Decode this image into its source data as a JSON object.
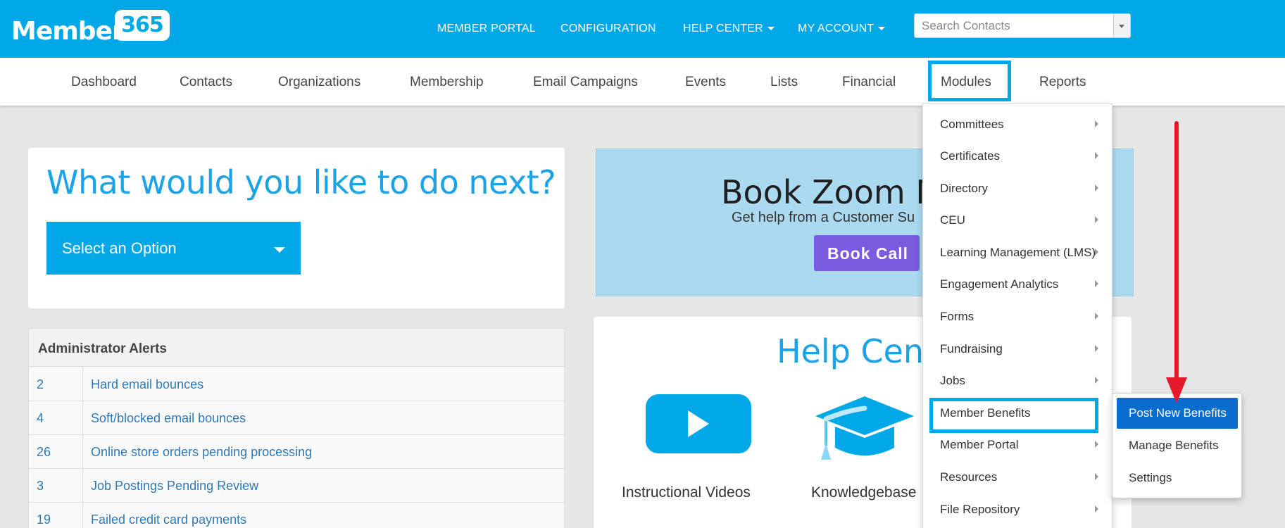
{
  "header": {
    "logo_text": "Member",
    "logo_badge": "365",
    "nav": [
      {
        "label": "MEMBER PORTAL"
      },
      {
        "label": "CONFIGURATION"
      },
      {
        "label": "HELP CENTER"
      },
      {
        "label": "MY ACCOUNT"
      }
    ],
    "search": {
      "placeholder": "Search Contacts"
    }
  },
  "main_nav": {
    "items": [
      {
        "label": "Dashboard"
      },
      {
        "label": "Contacts"
      },
      {
        "label": "Organizations"
      },
      {
        "label": "Membership"
      },
      {
        "label": "Email Campaigns"
      },
      {
        "label": "Events"
      },
      {
        "label": "Lists"
      },
      {
        "label": "Financial"
      },
      {
        "label": "Modules"
      },
      {
        "label": "Reports"
      }
    ]
  },
  "next_card": {
    "title": "What would you like to do next?",
    "select_label": "Select an Option"
  },
  "alerts": {
    "heading": "Administrator Alerts",
    "rows": [
      {
        "count": "2",
        "text": "Hard email bounces"
      },
      {
        "count": "4",
        "text": "Soft/blocked email bounces"
      },
      {
        "count": "26",
        "text": "Online store orders pending processing"
      },
      {
        "count": "3",
        "text": "Job Postings Pending Review"
      },
      {
        "count": "19",
        "text": "Failed credit card payments"
      }
    ]
  },
  "zoom_card": {
    "title": "Book Zoom M",
    "subtitle": "Get help from a Customer Su",
    "button": "Book Call"
  },
  "help_center": {
    "title": "Help Cente",
    "tiles": [
      {
        "label": "Instructional Videos",
        "icon": "youtube-play-icon"
      },
      {
        "label": "Knowledgebase",
        "icon": "graduation-cap-icon"
      }
    ]
  },
  "modules_menu": {
    "items": [
      {
        "label": "Committees"
      },
      {
        "label": "Certificates"
      },
      {
        "label": "Directory"
      },
      {
        "label": "CEU"
      },
      {
        "label": "Learning Management (LMS)"
      },
      {
        "label": "Engagement Analytics"
      },
      {
        "label": "Forms"
      },
      {
        "label": "Fundraising"
      },
      {
        "label": "Jobs"
      },
      {
        "label": "Member Benefits"
      },
      {
        "label": "Member Portal"
      },
      {
        "label": "Resources"
      },
      {
        "label": "File Repository"
      }
    ]
  },
  "benefits_submenu": {
    "items": [
      {
        "label": "Post New Benefits"
      },
      {
        "label": "Manage Benefits"
      },
      {
        "label": "Settings"
      }
    ]
  },
  "colors": {
    "brand_blue": "#00a8e8",
    "highlight_blue": "#0b6ccf",
    "annotation_red": "#e5192b",
    "book_call_purple": "#7b5ce0"
  }
}
